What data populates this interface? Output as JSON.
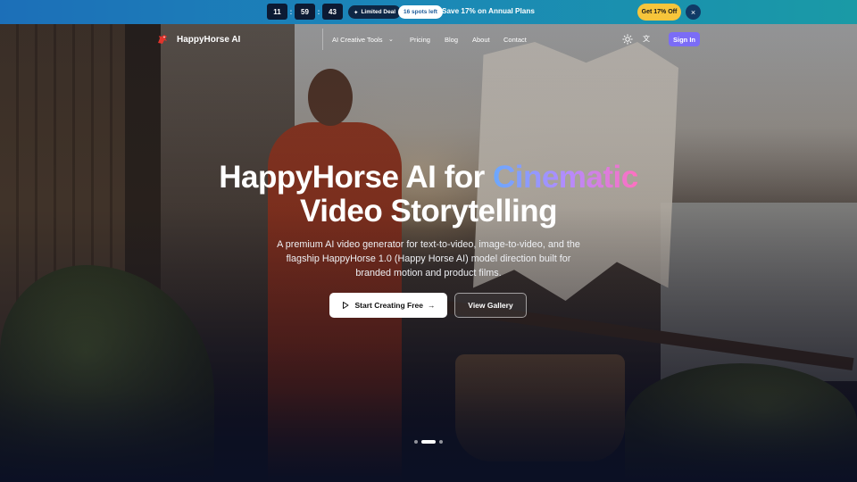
{
  "promo": {
    "timer": {
      "hours": "11",
      "minutes": "59",
      "seconds": "43",
      "separator": ":"
    },
    "deal_badge": "Limited Deal",
    "spots_badge": "16 spots left",
    "save_text": "Save 17% on Annual Plans",
    "cta_label": "Get 17% Off",
    "close_icon": "×"
  },
  "nav": {
    "brand": "HappyHorse AI",
    "menu": [
      "AI Creative Tools",
      "Pricing",
      "Blog",
      "About",
      "Contact"
    ],
    "dropdown_icon": "chevron-down-icon",
    "signin_label": "Sign In"
  },
  "hero": {
    "title_part1": "HappyHorse AI for ",
    "title_accent": "Cinematic",
    "title_line2": "Video Storytelling",
    "subtitle": "A premium AI video generator for text-to-video, image-to-video, and the flagship HappyHorse 1.0 (Happy Horse AI) model direction built for branded motion and product films.",
    "primary_cta": "Start Creating Free",
    "primary_arrow": "→",
    "secondary_cta": "View Gallery",
    "slides": {
      "count": 3,
      "active": 2
    }
  },
  "colors": {
    "accent_gradient": [
      "#6aa8ff",
      "#b28cff",
      "#ff6fc0"
    ],
    "cta_yellow": "#f6c53b",
    "signin_purple": "#7b6cf6"
  }
}
